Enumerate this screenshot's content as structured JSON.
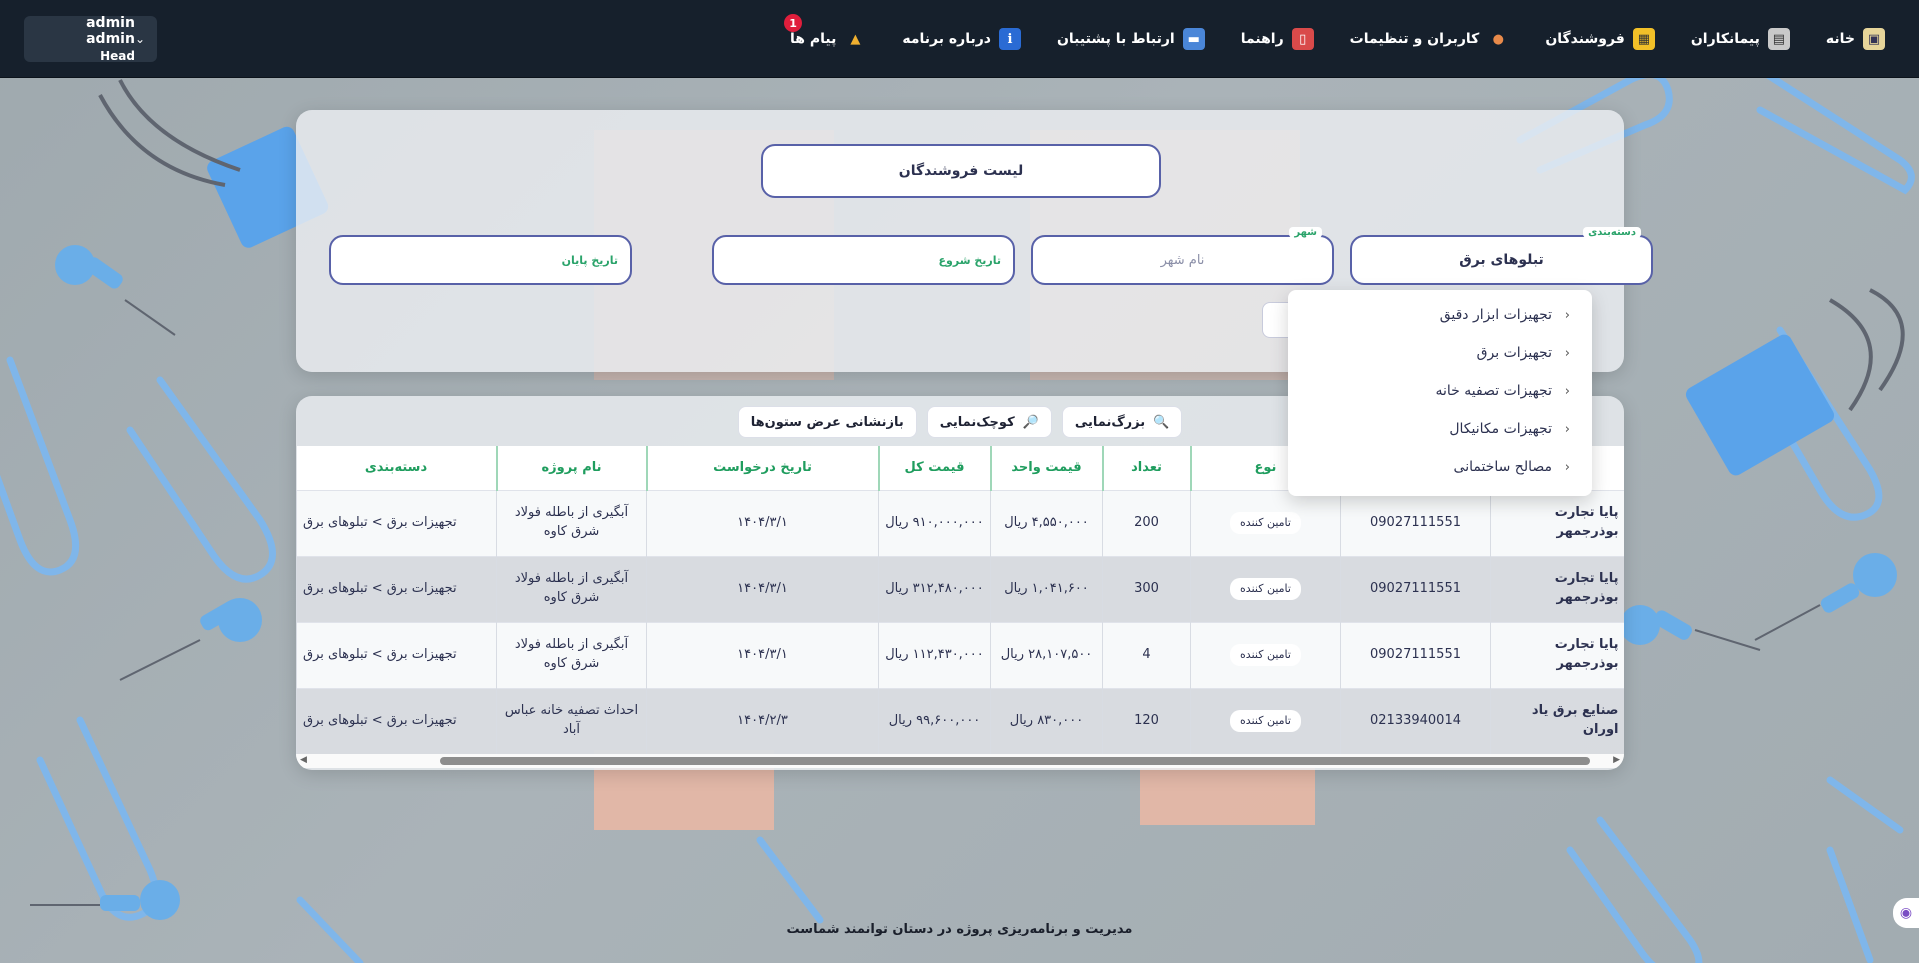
{
  "nav": {
    "items": [
      {
        "label": "خانه",
        "icon": "home-icon"
      },
      {
        "label": "پیمانکاران",
        "icon": "contractors-icon"
      },
      {
        "label": "فروشندگان",
        "icon": "sellers-icon"
      },
      {
        "label": "کاربران و تنظیمات",
        "icon": "users-settings-icon"
      },
      {
        "label": "راهنما",
        "icon": "guide-icon"
      },
      {
        "label": "ارتباط با پشتیبان",
        "icon": "support-chat-icon"
      },
      {
        "label": "درباره برنامه",
        "icon": "info-icon"
      },
      {
        "label": "پیام ها",
        "icon": "bell-icon",
        "badge": "1"
      }
    ]
  },
  "user": {
    "name": "admin admin",
    "role": "Head"
  },
  "filter": {
    "title": "لیست فروشندگان",
    "category_label": "دسته‌بندی",
    "category_value": "تبلوهای برق",
    "city_label": "شهر",
    "city_placeholder": "نام شهر",
    "start_date_label": "تاریخ شروع",
    "end_date_label": "تاریخ پایان",
    "partial_button": "ن"
  },
  "dropdown": {
    "items": [
      "تجهیزات ابزار دقیق",
      "تجهیزات برق",
      "تجهیزات تصفیه خانه",
      "تجهیزات مکانیکال",
      "مصالح ساختمانی"
    ]
  },
  "toolbar": {
    "zoom_in": "بزرگ‌نمایی",
    "zoom_out": "کوچک‌نمایی",
    "reset_cols": "بازنشانی عرض ستون‌ها"
  },
  "table": {
    "headers": [
      "نا",
      "",
      "نوع",
      "تعداد",
      "قیمت واحد",
      "قیمت کل",
      "تاریخ درخواست",
      "نام پروژه",
      "دسته‌بندی"
    ],
    "rows": [
      {
        "name": "پایا تجارت بوذرجمهر",
        "phone": "09027111551",
        "type": "تامین کننده",
        "qty": "200",
        "unit": "۴,۵۵۰,۰۰۰ ریال",
        "total": "۹۱۰,۰۰۰,۰۰۰ ریال",
        "date": "۱۴۰۴/۳/۱",
        "project": "آبگیری از باطله فولاد شرق کاوه",
        "category": "تجهیزات برق > تبلوهای برق"
      },
      {
        "name": "پایا تجارت بوذرجمهر",
        "phone": "09027111551",
        "type": "تامین کننده",
        "qty": "300",
        "unit": "۱,۰۴۱,۶۰۰ ریال",
        "total": "۳۱۲,۴۸۰,۰۰۰ ریال",
        "date": "۱۴۰۴/۳/۱",
        "project": "آبگیری از باطله فولاد شرق کاوه",
        "category": "تجهیزات برق > تبلوهای برق"
      },
      {
        "name": "پایا تجارت بوذرجمهر",
        "phone": "09027111551",
        "type": "تامین کننده",
        "qty": "4",
        "unit": "۲۸,۱۰۷,۵۰۰ ریال",
        "total": "۱۱۲,۴۳۰,۰۰۰ ریال",
        "date": "۱۴۰۴/۳/۱",
        "project": "آبگیری از باطله فولاد شرق کاوه",
        "category": "تجهیزات برق > تبلوهای برق"
      },
      {
        "name": "صنایع برق یاد اوران",
        "phone": "02133940014",
        "type": "تامین کننده",
        "qty": "120",
        "unit": "۸۳۰,۰۰۰ ریال",
        "total": "۹۹,۶۰۰,۰۰۰ ریال",
        "date": "۱۴۰۴/۲/۳",
        "project": "احداث تصفیه خانه عباس آباد",
        "category": "تجهیزات برق > تبلوهای برق"
      }
    ]
  },
  "footer": {
    "text": "مدیریت و برنامه‌ریزی پروژه در دستان توانمند شماست"
  }
}
